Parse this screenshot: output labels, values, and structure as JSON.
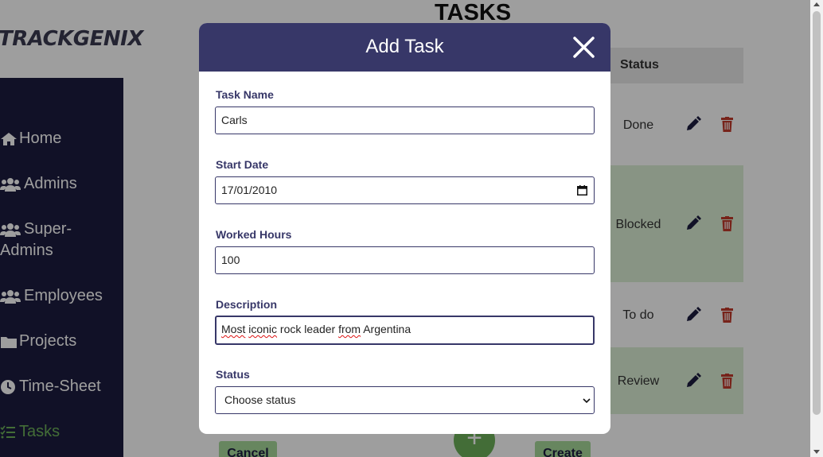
{
  "app": {
    "logo": "TRACKGENIX"
  },
  "sidebar": {
    "items": [
      {
        "label": "Home",
        "icon": "home-icon"
      },
      {
        "label": "Admins",
        "icon": "users-icon"
      },
      {
        "label": "Super-\nAdmins",
        "icon": "users-icon"
      },
      {
        "label": "Employees",
        "icon": "users-icon"
      },
      {
        "label": "Projects",
        "icon": "folder-icon"
      },
      {
        "label": "Time-Sheet",
        "icon": "clock-icon"
      },
      {
        "label": "Tasks",
        "icon": "tasks-icon",
        "active": true
      }
    ]
  },
  "page": {
    "title": "TASKS",
    "table": {
      "status_header": "Status",
      "rows": [
        {
          "status": "Done"
        },
        {
          "status": "Blocked"
        },
        {
          "status": "To do"
        },
        {
          "status": "Review"
        }
      ]
    },
    "add_button": "+",
    "cancel_label": "Cancel",
    "create_label": "Create"
  },
  "modal": {
    "title": "Add Task",
    "fields": {
      "task_name": {
        "label": "Task Name",
        "value": "Carls"
      },
      "start_date": {
        "label": "Start Date",
        "value": "17/01/2010"
      },
      "worked_hours": {
        "label": "Worked Hours",
        "value": "100"
      },
      "description": {
        "label": "Description",
        "value": "Most iconic rock leader from Argentina",
        "parts": [
          "Most",
          " ",
          "iconic",
          " rock leader ",
          "from",
          " Argentina"
        ]
      },
      "status": {
        "label": "Status",
        "value": "Choose status"
      }
    }
  },
  "colors": {
    "sidebar_bg": "#1c1c3f",
    "modal_header": "#373768",
    "accent_green": "#6db159",
    "row_highlight": "#dcefd6",
    "delete_red": "#c0392b"
  }
}
